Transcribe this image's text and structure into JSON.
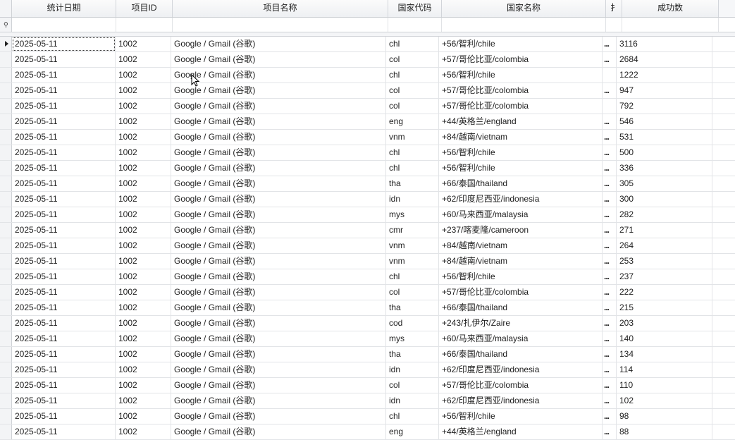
{
  "columns": {
    "date": "统计日期",
    "project_id": "项目ID",
    "project_name": "项目名称",
    "country_code": "国家代码",
    "country_name": "国家名称",
    "truncated": "扌",
    "success_count": "成功数"
  },
  "rows": [
    {
      "date": "2025-05-11",
      "project_id": "1002",
      "project_name": "Google / Gmail (谷歌)",
      "country_code": "chl",
      "country_name": "+56/智利/chile",
      "dots": "...",
      "success_count": "3116"
    },
    {
      "date": "2025-05-11",
      "project_id": "1002",
      "project_name": "Google / Gmail (谷歌)",
      "country_code": "col",
      "country_name": "+57/哥伦比亚/colombia",
      "dots": "...",
      "success_count": "2684"
    },
    {
      "date": "2025-05-11",
      "project_id": "1002",
      "project_name": "Google / Gmail (谷歌)",
      "country_code": "chl",
      "country_name": "+56/智利/chile",
      "dots": "",
      "success_count": "1222"
    },
    {
      "date": "2025-05-11",
      "project_id": "1002",
      "project_name": "Google / Gmail (谷歌)",
      "country_code": "col",
      "country_name": "+57/哥伦比亚/colombia",
      "dots": "...",
      "success_count": "947"
    },
    {
      "date": "2025-05-11",
      "project_id": "1002",
      "project_name": "Google / Gmail (谷歌)",
      "country_code": "col",
      "country_name": "+57/哥伦比亚/colombia",
      "dots": "",
      "success_count": "792"
    },
    {
      "date": "2025-05-11",
      "project_id": "1002",
      "project_name": "Google / Gmail (谷歌)",
      "country_code": "eng",
      "country_name": "+44/英格兰/england",
      "dots": "...",
      "success_count": "546"
    },
    {
      "date": "2025-05-11",
      "project_id": "1002",
      "project_name": "Google / Gmail (谷歌)",
      "country_code": "vnm",
      "country_name": "+84/越南/vietnam",
      "dots": "...",
      "success_count": "531"
    },
    {
      "date": "2025-05-11",
      "project_id": "1002",
      "project_name": "Google / Gmail (谷歌)",
      "country_code": "chl",
      "country_name": "+56/智利/chile",
      "dots": "...",
      "success_count": "500"
    },
    {
      "date": "2025-05-11",
      "project_id": "1002",
      "project_name": "Google / Gmail (谷歌)",
      "country_code": "chl",
      "country_name": "+56/智利/chile",
      "dots": "...",
      "success_count": "336"
    },
    {
      "date": "2025-05-11",
      "project_id": "1002",
      "project_name": "Google / Gmail (谷歌)",
      "country_code": "tha",
      "country_name": "+66/泰国/thailand",
      "dots": "...",
      "success_count": "305"
    },
    {
      "date": "2025-05-11",
      "project_id": "1002",
      "project_name": "Google / Gmail (谷歌)",
      "country_code": "idn",
      "country_name": "+62/印度尼西亚/indonesia",
      "dots": "...",
      "success_count": "300"
    },
    {
      "date": "2025-05-11",
      "project_id": "1002",
      "project_name": "Google / Gmail (谷歌)",
      "country_code": "mys",
      "country_name": "+60/马来西亚/malaysia",
      "dots": "...",
      "success_count": "282"
    },
    {
      "date": "2025-05-11",
      "project_id": "1002",
      "project_name": "Google / Gmail (谷歌)",
      "country_code": "cmr",
      "country_name": "+237/喀麦隆/cameroon",
      "dots": "...",
      "success_count": "271"
    },
    {
      "date": "2025-05-11",
      "project_id": "1002",
      "project_name": "Google / Gmail (谷歌)",
      "country_code": "vnm",
      "country_name": "+84/越南/vietnam",
      "dots": "...",
      "success_count": "264"
    },
    {
      "date": "2025-05-11",
      "project_id": "1002",
      "project_name": "Google / Gmail (谷歌)",
      "country_code": "vnm",
      "country_name": "+84/越南/vietnam",
      "dots": "...",
      "success_count": "253"
    },
    {
      "date": "2025-05-11",
      "project_id": "1002",
      "project_name": "Google / Gmail (谷歌)",
      "country_code": "chl",
      "country_name": "+56/智利/chile",
      "dots": "...",
      "success_count": "237"
    },
    {
      "date": "2025-05-11",
      "project_id": "1002",
      "project_name": "Google / Gmail (谷歌)",
      "country_code": "col",
      "country_name": "+57/哥伦比亚/colombia",
      "dots": "...",
      "success_count": "222"
    },
    {
      "date": "2025-05-11",
      "project_id": "1002",
      "project_name": "Google / Gmail (谷歌)",
      "country_code": "tha",
      "country_name": "+66/泰国/thailand",
      "dots": "...",
      "success_count": "215"
    },
    {
      "date": "2025-05-11",
      "project_id": "1002",
      "project_name": "Google / Gmail (谷歌)",
      "country_code": "cod",
      "country_name": "+243/扎伊尔/Zaire",
      "dots": "...",
      "success_count": "203"
    },
    {
      "date": "2025-05-11",
      "project_id": "1002",
      "project_name": "Google / Gmail (谷歌)",
      "country_code": "mys",
      "country_name": "+60/马来西亚/malaysia",
      "dots": "...",
      "success_count": "140"
    },
    {
      "date": "2025-05-11",
      "project_id": "1002",
      "project_name": "Google / Gmail (谷歌)",
      "country_code": "tha",
      "country_name": "+66/泰国/thailand",
      "dots": "...",
      "success_count": "134"
    },
    {
      "date": "2025-05-11",
      "project_id": "1002",
      "project_name": "Google / Gmail (谷歌)",
      "country_code": "idn",
      "country_name": "+62/印度尼西亚/indonesia",
      "dots": "...",
      "success_count": "114"
    },
    {
      "date": "2025-05-11",
      "project_id": "1002",
      "project_name": "Google / Gmail (谷歌)",
      "country_code": "col",
      "country_name": "+57/哥伦比亚/colombia",
      "dots": "...",
      "success_count": "110"
    },
    {
      "date": "2025-05-11",
      "project_id": "1002",
      "project_name": "Google / Gmail (谷歌)",
      "country_code": "idn",
      "country_name": "+62/印度尼西亚/indonesia",
      "dots": "...",
      "success_count": "102"
    },
    {
      "date": "2025-05-11",
      "project_id": "1002",
      "project_name": "Google / Gmail (谷歌)",
      "country_code": "chl",
      "country_name": "+56/智利/chile",
      "dots": "...",
      "success_count": "98"
    },
    {
      "date": "2025-05-11",
      "project_id": "1002",
      "project_name": "Google / Gmail (谷歌)",
      "country_code": "eng",
      "country_name": "+44/英格兰/england",
      "dots": "...",
      "success_count": "88"
    }
  ],
  "icons": {
    "filter_row": "filter-icon",
    "current_row": "row-pointer-icon",
    "mouse": "mouse-cursor-icon"
  },
  "colors": {
    "header_bg": "#eef0f3",
    "grid_line": "#e2e4e7",
    "indicator_bg": "#f3f4f6"
  }
}
